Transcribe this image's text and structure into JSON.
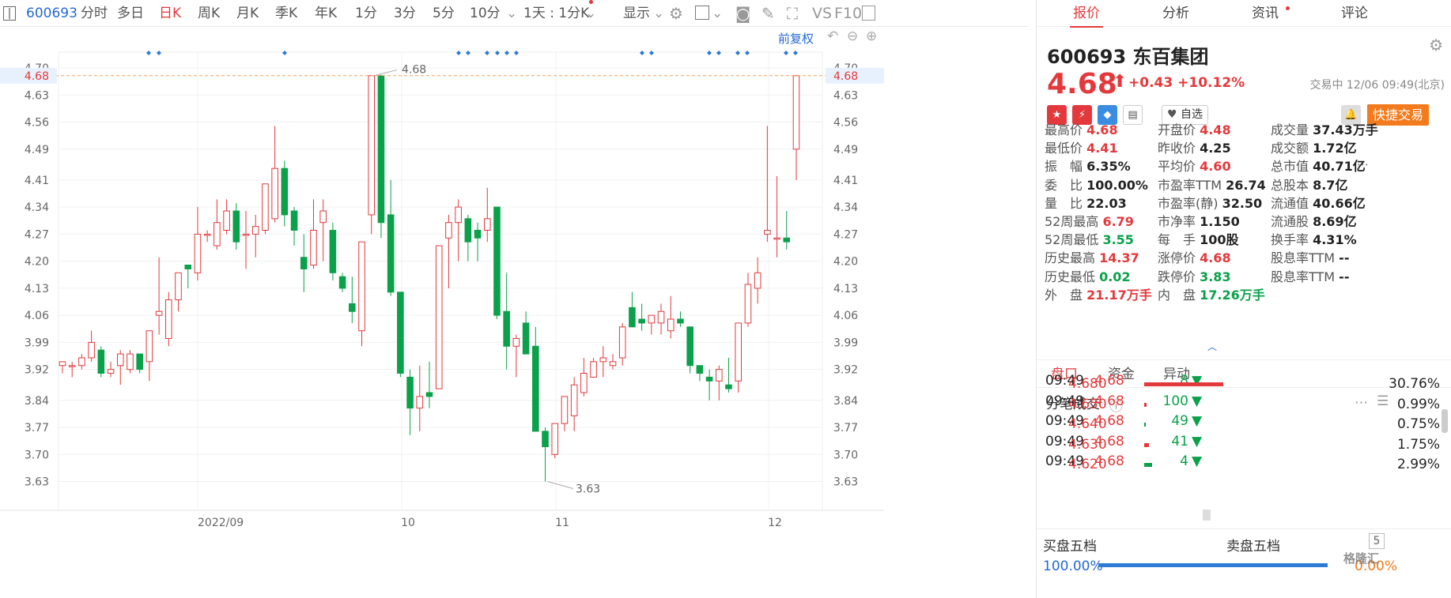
{
  "toolbar": {
    "code": "600693",
    "items": [
      "分时",
      "多日",
      "日K",
      "周K",
      "月K",
      "季K",
      "年K",
      "1分",
      "3分",
      "5分",
      "10分"
    ],
    "period": "1天 : 1分K",
    "show": "显示",
    "vs": "VS",
    "f10": "F10"
  },
  "chart_labels": {
    "restore": "前复权",
    "last_price": "4.68",
    "high_label": "4.68",
    "low_label": "3.63"
  },
  "chart_data": {
    "type": "candlestick",
    "y_ticks": [
      "4.70",
      "4.63",
      "4.56",
      "4.49",
      "4.41",
      "4.34",
      "4.27",
      "4.20",
      "4.13",
      "4.06",
      "3.99",
      "3.92",
      "3.84",
      "3.77",
      "3.70",
      "3.63"
    ],
    "x_ticks": [
      "2022/09",
      "10",
      "11",
      "12"
    ],
    "ylim": [
      3.58,
      4.7
    ],
    "ohlc": [
      [
        3.93,
        3.94,
        3.91,
        3.94
      ],
      [
        3.93,
        3.94,
        3.9,
        3.93
      ],
      [
        3.93,
        3.96,
        3.92,
        3.95
      ],
      [
        3.95,
        4.02,
        3.94,
        3.99
      ],
      [
        3.97,
        3.98,
        3.9,
        3.91
      ],
      [
        3.91,
        3.94,
        3.9,
        3.92
      ],
      [
        3.93,
        3.97,
        3.88,
        3.96
      ],
      [
        3.92,
        3.97,
        3.91,
        3.96
      ],
      [
        3.96,
        3.96,
        3.91,
        3.92
      ],
      [
        3.94,
        4.02,
        3.89,
        4.02
      ],
      [
        4.06,
        4.21,
        4.01,
        4.07
      ],
      [
        4.0,
        4.12,
        3.98,
        4.1
      ],
      [
        4.1,
        4.16,
        4.07,
        4.17
      ],
      [
        4.19,
        4.19,
        4.13,
        4.18
      ],
      [
        4.17,
        4.34,
        4.15,
        4.27
      ],
      [
        4.27,
        4.28,
        4.25,
        4.27
      ],
      [
        4.24,
        4.36,
        4.23,
        4.3
      ],
      [
        4.28,
        4.36,
        4.27,
        4.33
      ],
      [
        4.33,
        4.35,
        4.23,
        4.25
      ],
      [
        4.27,
        4.33,
        4.18,
        4.27
      ],
      [
        4.27,
        4.32,
        4.21,
        4.29
      ],
      [
        4.28,
        4.4,
        4.27,
        4.4
      ],
      [
        4.31,
        4.55,
        4.3,
        4.44
      ],
      [
        4.44,
        4.46,
        4.29,
        4.32
      ],
      [
        4.33,
        4.34,
        4.24,
        4.28
      ],
      [
        4.21,
        4.27,
        4.12,
        4.18
      ],
      [
        4.19,
        4.36,
        4.18,
        4.28
      ],
      [
        4.3,
        4.36,
        4.2,
        4.33
      ],
      [
        4.28,
        4.3,
        4.15,
        4.17
      ],
      [
        4.16,
        4.17,
        4.12,
        4.13
      ],
      [
        4.09,
        4.16,
        4.04,
        4.07
      ],
      [
        4.02,
        4.25,
        3.98,
        4.25
      ],
      [
        4.32,
        4.68,
        4.27,
        4.68
      ],
      [
        4.68,
        4.68,
        4.26,
        4.3
      ],
      [
        4.32,
        4.41,
        4.11,
        4.12
      ],
      [
        4.12,
        4.12,
        3.9,
        3.91
      ],
      [
        3.9,
        3.92,
        3.75,
        3.82
      ],
      [
        3.82,
        3.93,
        3.76,
        3.85
      ],
      [
        3.86,
        3.94,
        3.82,
        3.85
      ],
      [
        3.87,
        4.24,
        3.87,
        4.24
      ],
      [
        4.26,
        4.32,
        4.13,
        4.3
      ],
      [
        4.3,
        4.36,
        4.2,
        4.34
      ],
      [
        4.31,
        4.32,
        4.2,
        4.25
      ],
      [
        4.28,
        4.3,
        4.2,
        4.26
      ],
      [
        4.28,
        4.39,
        4.25,
        4.31
      ],
      [
        4.34,
        4.34,
        4.05,
        4.06
      ],
      [
        4.07,
        4.17,
        3.92,
        3.98
      ],
      [
        3.98,
        4.01,
        3.9,
        4.0
      ],
      [
        4.04,
        4.07,
        3.96,
        3.96
      ],
      [
        3.98,
        4.03,
        3.8,
        3.76
      ],
      [
        3.76,
        3.77,
        3.63,
        3.72
      ],
      [
        3.7,
        3.78,
        3.69,
        3.78
      ],
      [
        3.78,
        3.85,
        3.76,
        3.85
      ],
      [
        3.8,
        3.9,
        3.76,
        3.88
      ],
      [
        3.86,
        3.95,
        3.85,
        3.91
      ],
      [
        3.9,
        3.95,
        3.9,
        3.94
      ],
      [
        3.94,
        3.98,
        3.9,
        3.95
      ],
      [
        3.93,
        3.96,
        3.92,
        3.94
      ],
      [
        3.95,
        4.04,
        3.93,
        4.03
      ],
      [
        4.08,
        4.12,
        4.06,
        4.03
      ],
      [
        4.05,
        4.09,
        4.02,
        4.04
      ],
      [
        4.04,
        4.06,
        4.01,
        4.06
      ],
      [
        4.04,
        4.09,
        4.01,
        4.07
      ],
      [
        4.02,
        4.11,
        4.0,
        4.05
      ],
      [
        4.05,
        4.07,
        4.03,
        4.04
      ],
      [
        4.03,
        4.03,
        3.91,
        3.93
      ],
      [
        3.93,
        3.93,
        3.89,
        3.91
      ],
      [
        3.9,
        3.92,
        3.84,
        3.89
      ],
      [
        3.89,
        3.93,
        3.84,
        3.92
      ],
      [
        3.88,
        3.95,
        3.86,
        3.87
      ],
      [
        3.89,
        4.04,
        3.86,
        4.04
      ],
      [
        4.04,
        4.17,
        4.03,
        4.14
      ],
      [
        4.13,
        4.21,
        4.09,
        4.17
      ],
      [
        4.27,
        4.55,
        4.25,
        4.28
      ],
      [
        4.26,
        4.42,
        4.21,
        4.26
      ],
      [
        4.26,
        4.33,
        4.23,
        4.25
      ],
      [
        4.49,
        4.68,
        4.41,
        4.68
      ]
    ]
  },
  "right": {
    "tabs": [
      "报价",
      "分析",
      "资讯",
      "评论"
    ],
    "name": "600693 东百集团",
    "price": "4.68",
    "change": "+0.43",
    "pct": "+10.12%",
    "time": "交易中 12/06 09:49(北京)",
    "zixuan": "自选",
    "fast": "快捷交易",
    "stats": [
      [
        "最高价",
        "4.68",
        "up"
      ],
      [
        "开盘价",
        "4.48",
        "up"
      ],
      [
        "成交量",
        "37.43万手",
        "blk"
      ],
      [
        "最低价",
        "4.41",
        "up"
      ],
      [
        "昨收价",
        "4.25",
        "blk"
      ],
      [
        "成交额",
        "1.72亿",
        "blk"
      ],
      [
        "振　幅",
        "6.35%",
        "blk"
      ],
      [
        "平均价",
        "4.60",
        "up"
      ],
      [
        "总市值",
        "40.71亿",
        "blk"
      ],
      [
        "委　比",
        "100.00%",
        "blk"
      ],
      [
        "市盈率TTM",
        "26.74",
        "blk"
      ],
      [
        "总股本",
        "8.7亿",
        "blk"
      ],
      [
        "量　比",
        "22.03",
        "blk"
      ],
      [
        "市盈率(静)",
        "32.50",
        "blk"
      ],
      [
        "流通值",
        "40.66亿",
        "blk"
      ],
      [
        "52周最高",
        "6.79",
        "up"
      ],
      [
        "市净率",
        "1.150",
        "blk"
      ],
      [
        "流通股",
        "8.69亿",
        "blk"
      ],
      [
        "52周最低",
        "3.55",
        "dn"
      ],
      [
        "每　手",
        "100股",
        "blk"
      ],
      [
        "换手率",
        "4.31%",
        "blk"
      ],
      [
        "历史最高",
        "14.37",
        "up"
      ],
      [
        "涨停价",
        "4.68",
        "up"
      ],
      [
        "股息率TTM",
        "--",
        "blk"
      ],
      [
        "历史最低",
        "0.02",
        "dn"
      ],
      [
        "跌停价",
        "3.83",
        "dn"
      ],
      [
        "股息率TTM",
        "--",
        "blk"
      ],
      [
        "外　盘",
        "21.17万手",
        "up"
      ],
      [
        "内　盘",
        "17.26万手",
        "dn"
      ]
    ],
    "subtabs": [
      "盘口",
      "资金",
      "异动"
    ],
    "ticks_title": "分笔成交",
    "ticks": [
      [
        "09:49",
        "4.68",
        "8"
      ],
      [
        "09:49",
        "4.68",
        "100"
      ],
      [
        "09:49",
        "4.68",
        "49"
      ],
      [
        "09:49",
        "4.68",
        "41"
      ],
      [
        "09:49",
        "4.68",
        "4"
      ]
    ],
    "levels": [
      [
        "4.680",
        "30.76%"
      ],
      [
        "4.650",
        "0.99%"
      ],
      [
        "4.640",
        "0.75%"
      ],
      [
        "4.630",
        "1.75%"
      ],
      [
        "4.620",
        "2.99%"
      ]
    ],
    "buy5": "买盘五档",
    "sell5": "卖盘五档",
    "five": "5",
    "buy_pct": "100.00%",
    "sell_pct": "0.00%",
    "watermark": "格隆汇"
  }
}
